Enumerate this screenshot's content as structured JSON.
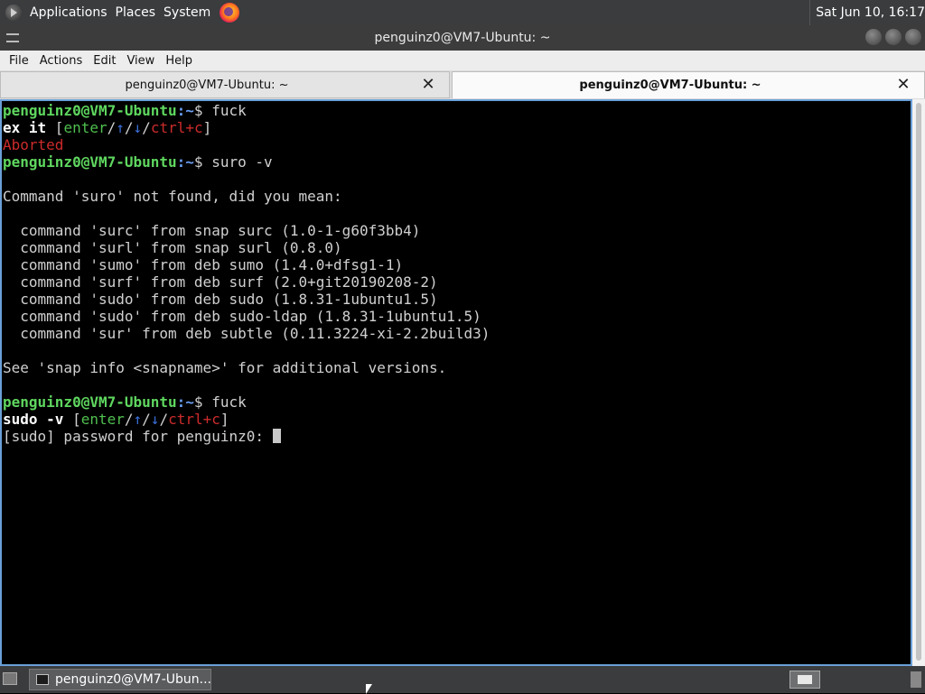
{
  "top_panel": {
    "menus": [
      "Applications",
      "Places",
      "System"
    ],
    "clock": "Sat Jun 10, 16:17"
  },
  "window": {
    "title": "penguinz0@VM7-Ubuntu: ~"
  },
  "menubar": {
    "items": [
      "File",
      "Actions",
      "Edit",
      "View",
      "Help"
    ]
  },
  "tabs": [
    {
      "label": "penguinz0@VM7-Ubuntu: ~",
      "active": false
    },
    {
      "label": "penguinz0@VM7-Ubuntu: ~",
      "active": true
    }
  ],
  "terminal": {
    "prompt_user": "penguinz0@VM7-Ubuntu",
    "prompt_path": ":~",
    "prompt_sign": "$ ",
    "cmd1": "fuck",
    "suggest1": "ex it",
    "aborted": "Aborted",
    "cmd2": "suro -v",
    "not_found": "Command 'suro' not found, did you mean:",
    "suggestions": [
      "  command 'surc' from snap surc (1.0-1-g60f3bb4)",
      "  command 'surl' from snap surl (0.8.0)",
      "  command 'sumo' from deb sumo (1.4.0+dfsg1-1)",
      "  command 'surf' from deb surf (2.0+git20190208-2)",
      "  command 'sudo' from deb sudo (1.8.31-1ubuntu1.5)",
      "  command 'sudo' from deb sudo-ldap (1.8.31-1ubuntu1.5)",
      "  command 'sur' from deb subtle (0.11.3224-xi-2.2build3)"
    ],
    "see_also": "See 'snap info <snapname>' for additional versions.",
    "cmd3": "fuck",
    "suggest2": "sudo -v",
    "hint_enter": "enter",
    "hint_up": "↑",
    "hint_down": "↓",
    "hint_ctrl": "ctrl+c",
    "password_prompt": "[sudo] password for penguinz0: "
  },
  "taskbar": {
    "task_label": "penguinz0@VM7-Ubun..."
  }
}
